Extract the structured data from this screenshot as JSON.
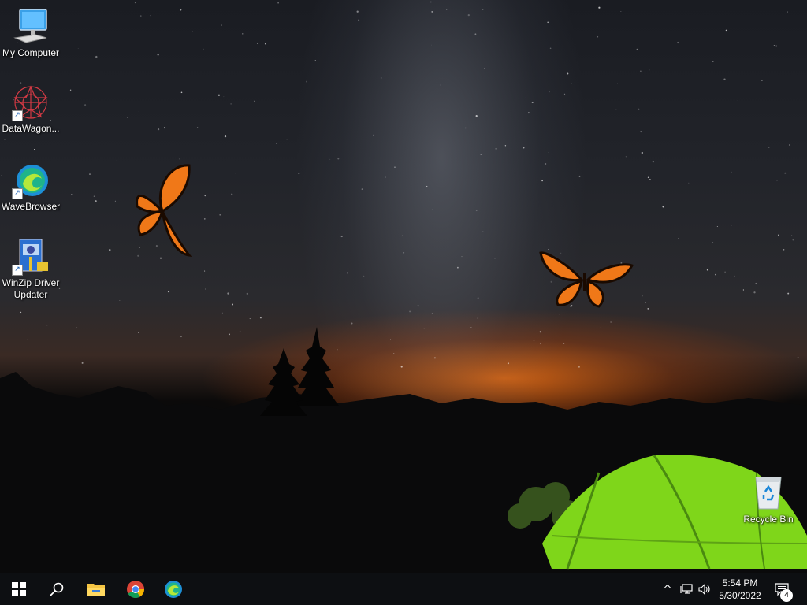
{
  "desktop": {
    "icons": [
      {
        "label": "My Computer",
        "icon": "computer-icon"
      },
      {
        "label": "DataWagon...",
        "icon": "datawagon-icon"
      },
      {
        "label": "WaveBrowser",
        "icon": "wavebrowser-icon"
      },
      {
        "label": "WinZip Driver Updater",
        "icon": "winzip-driver-updater-icon"
      },
      {
        "label": "Recycle Bin",
        "icon": "recycle-bin-icon"
      }
    ],
    "shortcut_arrow": "↗"
  },
  "taskbar": {
    "pinned": [
      "start-icon",
      "search-icon",
      "file-explorer-icon",
      "chrome-icon",
      "edge-icon"
    ],
    "tray": {
      "chevron": "^",
      "time": "5:54 PM",
      "date": "5/30/2022",
      "notification_count": "4"
    }
  },
  "colors": {
    "taskbar_bg": "#0d0f12",
    "tent_green": "#7fd61a",
    "butterfly_orange": "#f07818",
    "horizon_glow": "#eb6e14"
  }
}
